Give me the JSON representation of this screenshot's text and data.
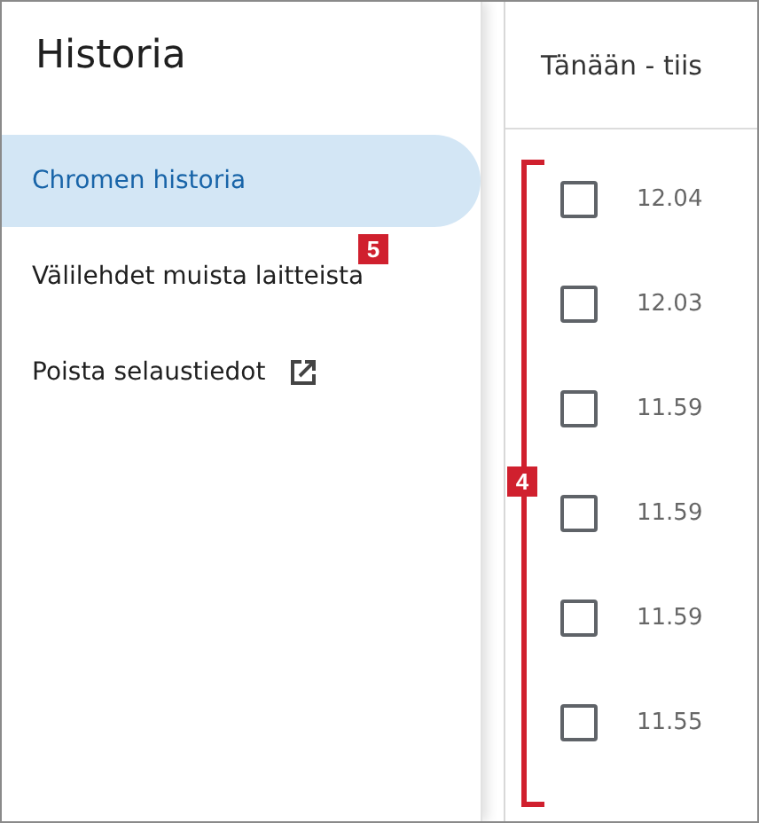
{
  "sidebar": {
    "title": "Historia",
    "items": [
      {
        "label": "Chromen historia",
        "selected": true,
        "external": false
      },
      {
        "label": "Välilehdet muista laitteista",
        "selected": false,
        "external": false
      },
      {
        "label": "Poista selaustiedot",
        "selected": false,
        "external": true
      }
    ]
  },
  "history": {
    "header": "Tänään - tiis",
    "rows": [
      {
        "time": "12.04",
        "checked": false
      },
      {
        "time": "12.03",
        "checked": false
      },
      {
        "time": "11.59",
        "checked": false
      },
      {
        "time": "11.59",
        "checked": false
      },
      {
        "time": "11.59",
        "checked": false
      },
      {
        "time": "11.55",
        "checked": false
      }
    ]
  },
  "annotations": [
    {
      "kind": "badge",
      "label": "5"
    },
    {
      "kind": "bracket",
      "label": "4"
    }
  ]
}
